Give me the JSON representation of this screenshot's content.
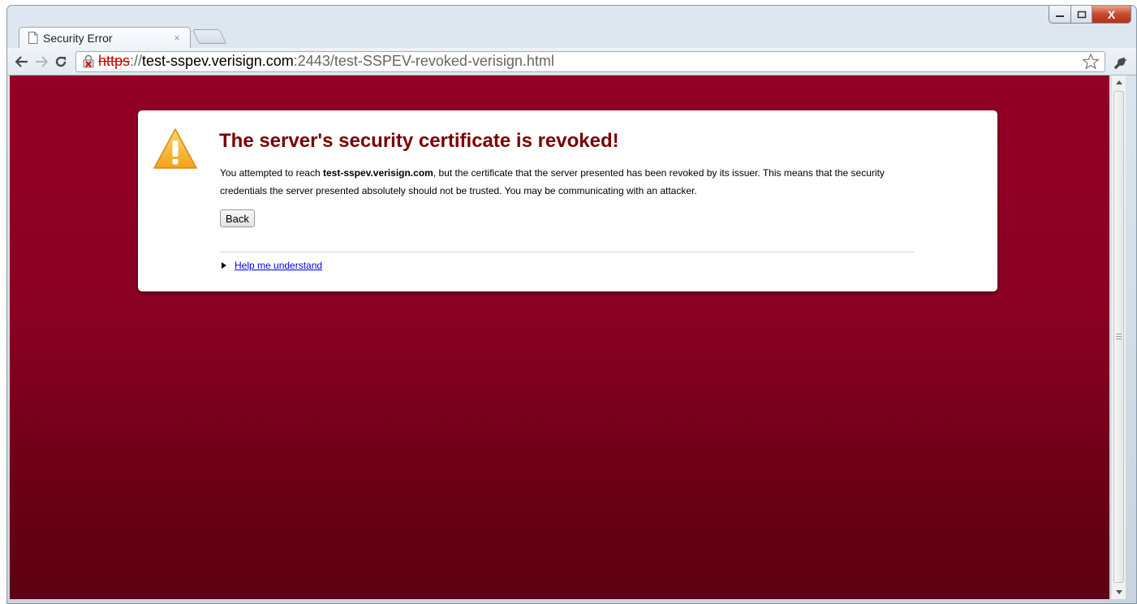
{
  "tab": {
    "title": "Security Error",
    "close": "×"
  },
  "window_controls": {
    "close": "X"
  },
  "omnibox": {
    "scheme": "https",
    "separator": "://",
    "host": "test-sspev.verisign.com",
    "rest": ":2443/test-SSPEV-revoked-verisign.html"
  },
  "error": {
    "title": "The server's security certificate is revoked!",
    "desc_prefix": "You attempted to reach ",
    "desc_host": "test-sspev.verisign.com",
    "desc_suffix": ", but the certificate that the server presented has been revoked by its issuer. This means that the security credentials the server presented absolutely should not be trusted. You may be communicating with an attacker.",
    "back_label": "Back",
    "help_label": "Help me understand"
  },
  "colors": {
    "background_top": "#940026",
    "background_bottom": "#5e0012",
    "title": "#7a0000",
    "link": "#0000ee"
  }
}
